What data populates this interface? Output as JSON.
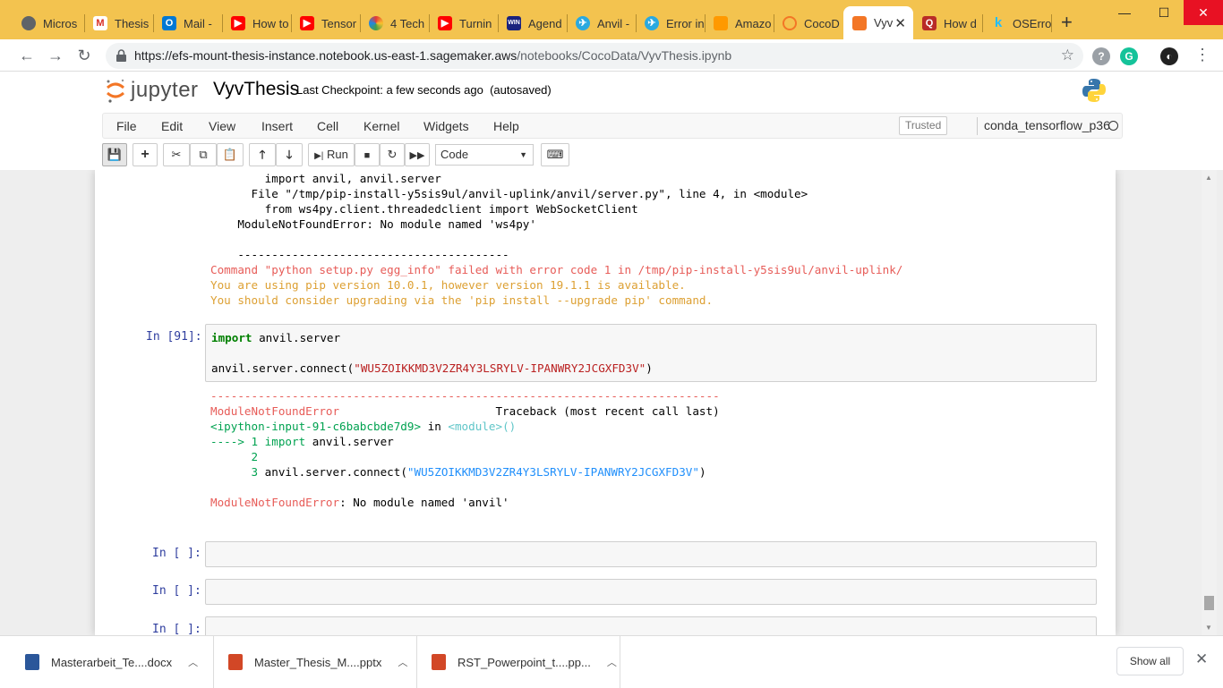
{
  "browser": {
    "tabs": [
      {
        "label": "Micros",
        "icon": "chrome-icon"
      },
      {
        "label": "Thesis",
        "icon": "gmail-icon"
      },
      {
        "label": "Mail -",
        "icon": "outlook-icon"
      },
      {
        "label": "How to",
        "icon": "youtube-icon"
      },
      {
        "label": "Tensor",
        "icon": "youtube-icon"
      },
      {
        "label": "4 Tech",
        "icon": "pinwheel-icon"
      },
      {
        "label": "Turnin",
        "icon": "youtube-icon"
      },
      {
        "label": "Agend",
        "icon": "win-icon"
      },
      {
        "label": "Anvil -",
        "icon": "anvil-icon"
      },
      {
        "label": "Error in",
        "icon": "anvil-icon"
      },
      {
        "label": "Amazo",
        "icon": "aws-icon"
      },
      {
        "label": "CocoD",
        "icon": "jupyter-icon"
      },
      {
        "label": "Vyv",
        "icon": "notebook-icon",
        "active": true
      },
      {
        "label": "How d",
        "icon": "quora-icon"
      },
      {
        "label": "OSErro",
        "icon": "kaggle-icon"
      }
    ],
    "url_host": "https://efs-mount-thesis-instance.notebook.us-east-1.sagemaker.aws",
    "url_path": "/notebooks/CocoData/VyvThesis.ipynb"
  },
  "jupyter": {
    "logo_text": "jupyter",
    "notebook_name": "VyvThesis",
    "checkpoint": "Last Checkpoint: a few seconds ago",
    "autosave": "(autosaved)",
    "menu": [
      "File",
      "Edit",
      "View",
      "Insert",
      "Cell",
      "Kernel",
      "Widgets",
      "Help"
    ],
    "trusted": "Trusted",
    "kernel": "conda_tensorflow_p36",
    "toolbar": {
      "run_label": "Run",
      "cell_type": "Code"
    }
  },
  "output_top": {
    "line1": "        import anvil, anvil.server",
    "line2": "      File \"/tmp/pip-install-y5sis9ul/anvil-uplink/anvil/server.py\", line 4, in <module>",
    "line3": "        from ws4py.client.threadedclient import WebSocketClient",
    "line4": "    ModuleNotFoundError: No module named 'ws4py'",
    "line5": "    ----------------------------------------",
    "err1": "Command \"python setup.py egg_info\" failed with error code 1 in /tmp/pip-install-y5sis9ul/anvil-uplink/",
    "warn1": "You are using pip version 10.0.1, however version 19.1.1 is available.",
    "warn2": "You should consider upgrading via the 'pip install --upgrade pip' command."
  },
  "cell91": {
    "prompt": "In [91]:",
    "kw_import": "import",
    "line1_rest": " anvil.server",
    "line3_pre": "anvil.server.connect(",
    "line3_str": "\"WU5ZOIKKMD3V2ZR4Y3LSRYLV-IPANWRY2JCGXFD3V\"",
    "line3_post": ")"
  },
  "traceback": {
    "dashes": "---------------------------------------------------------------------------",
    "err_name": "ModuleNotFoundError",
    "tb_label": "                       Traceback (most recent call last)",
    "input_ref": "<ipython-input-91-c6babcbde7d9>",
    "in_word": " in ",
    "module_ref": "<module>",
    "parens": "()",
    "arrow": "----> 1 ",
    "arrow_import": "import",
    "arrow_rest": " anvil.server",
    "l2": "      2",
    "l3_num": "      3 ",
    "l3_pre": "anvil.server.connect(",
    "l3_str": "\"WU5ZOIKKMD3V2ZR4Y3LSRYLV-IPANWRY2JCGXFD3V\"",
    "l3_post": ")",
    "final_name": "ModuleNotFoundError",
    "final_msg": ": No module named 'anvil'"
  },
  "empty_cells": [
    {
      "prompt": "In [ ]:"
    },
    {
      "prompt": "In [ ]:"
    },
    {
      "prompt": "In [ ]:"
    }
  ],
  "downloads": [
    {
      "name": "Masterarbeit_Te....docx",
      "icon": "word-doc-icon",
      "color": "#2b579a"
    },
    {
      "name": "Master_Thesis_M....pptx",
      "icon": "pptx-icon",
      "color": "#d24726"
    },
    {
      "name": "RST_Powerpoint_t....pp...",
      "icon": "pptx-icon",
      "color": "#d24726"
    }
  ],
  "show_all": "Show all"
}
